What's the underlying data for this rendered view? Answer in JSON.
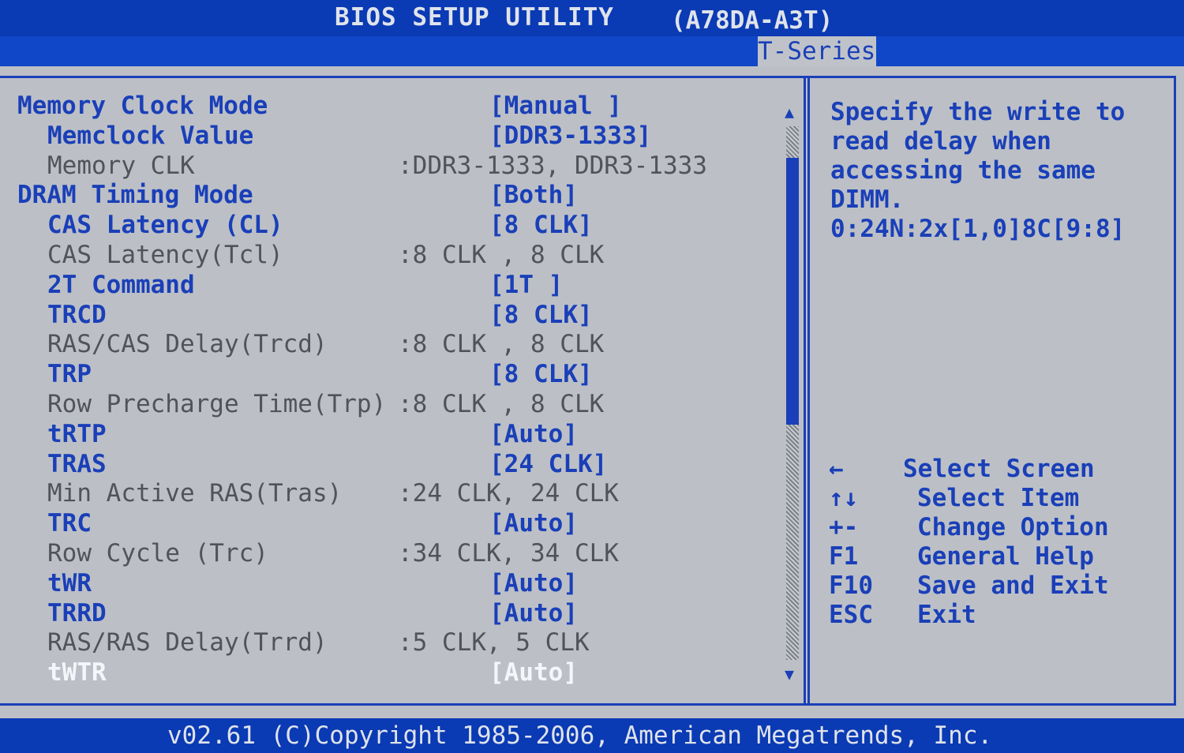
{
  "header": {
    "title": "BIOS SETUP UTILITY",
    "model": "(A78DA-A3T)"
  },
  "tabs": {
    "active": "T-Series"
  },
  "rows": [
    {
      "label": "Memory Clock Mode",
      "value": "[Manual ]",
      "style": "blue",
      "indent": 0,
      "kind": "bracket"
    },
    {
      "label": "Memclock Value",
      "value": "[DDR3-1333]",
      "style": "blue",
      "indent": 1,
      "kind": "bracket"
    },
    {
      "label": "Memory CLK",
      "value": ":DDR3-1333, DDR3-1333",
      "style": "gray",
      "indent": 1,
      "kind": "colon"
    },
    {
      "label": "DRAM Timing Mode",
      "value": "[Both]",
      "style": "blue",
      "indent": 0,
      "kind": "bracket"
    },
    {
      "label": "CAS Latency (CL)",
      "value": "[8 CLK]",
      "style": "blue",
      "indent": 1,
      "kind": "bracket"
    },
    {
      "label": "CAS Latency(Tcl)",
      "value": ":8 CLK , 8 CLK",
      "style": "gray",
      "indent": 1,
      "kind": "colon"
    },
    {
      "label": "2T Command",
      "value": "[1T ]",
      "style": "blue",
      "indent": 1,
      "kind": "bracket"
    },
    {
      "label": "TRCD",
      "value": "[8 CLK]",
      "style": "blue",
      "indent": 1,
      "kind": "bracket"
    },
    {
      "label": "RAS/CAS Delay(Trcd)",
      "value": ":8 CLK , 8 CLK",
      "style": "gray",
      "indent": 1,
      "kind": "colon"
    },
    {
      "label": "TRP",
      "value": "[8 CLK]",
      "style": "blue",
      "indent": 1,
      "kind": "bracket"
    },
    {
      "label": "Row Precharge Time(Trp)",
      "value": ":8 CLK , 8 CLK",
      "style": "gray",
      "indent": 1,
      "kind": "colon"
    },
    {
      "label": "tRTP",
      "value": "[Auto]",
      "style": "blue",
      "indent": 1,
      "kind": "bracket"
    },
    {
      "label": "TRAS",
      "value": "[24 CLK]",
      "style": "blue",
      "indent": 1,
      "kind": "bracket"
    },
    {
      "label": "Min Active RAS(Tras)",
      "value": ":24 CLK, 24 CLK",
      "style": "gray",
      "indent": 1,
      "kind": "colon"
    },
    {
      "label": "TRC",
      "value": "[Auto]",
      "style": "blue",
      "indent": 1,
      "kind": "bracket"
    },
    {
      "label": "Row Cycle (Trc)",
      "value": ":34 CLK, 34 CLK",
      "style": "gray",
      "indent": 1,
      "kind": "colon"
    },
    {
      "label": "tWR",
      "value": "[Auto]",
      "style": "blue",
      "indent": 1,
      "kind": "bracket"
    },
    {
      "label": "TRRD",
      "value": "[Auto]",
      "style": "blue",
      "indent": 1,
      "kind": "bracket"
    },
    {
      "label": "RAS/RAS Delay(Trrd)",
      "value": ":5 CLK, 5 CLK",
      "style": "gray",
      "indent": 1,
      "kind": "colon"
    },
    {
      "label": "tWTR",
      "value": "[Auto]",
      "style": "white",
      "indent": 1,
      "kind": "bracket"
    }
  ],
  "help": {
    "lines": [
      "Specify the write to",
      "read delay when",
      "accessing the same",
      "DIMM.",
      "0:24N:2x[1,0]8C[9:8]"
    ]
  },
  "keys": [
    {
      "glyph": "←",
      "desc": "Select Screen"
    },
    {
      "glyph": "↑↓",
      "desc": "Select Item"
    },
    {
      "glyph": "+-",
      "desc": "Change Option"
    },
    {
      "glyph": "F1",
      "desc": "General Help"
    },
    {
      "glyph": "F10",
      "desc": "Save and Exit"
    },
    {
      "glyph": "ESC",
      "desc": "Exit"
    }
  ],
  "footer": {
    "copyright": "v02.61 (C)Copyright 1985-2006, American Megatrends, Inc."
  },
  "colors": {
    "background_blue": "#0a3ab4",
    "panel_gray": "#bcc0c6",
    "text_blue": "#1a3fb8",
    "text_gray": "#505458",
    "selected_white": "#f4f6fa"
  },
  "scrollbar": {
    "up_icon": "arrow-up",
    "down_icon": "arrow-down"
  }
}
